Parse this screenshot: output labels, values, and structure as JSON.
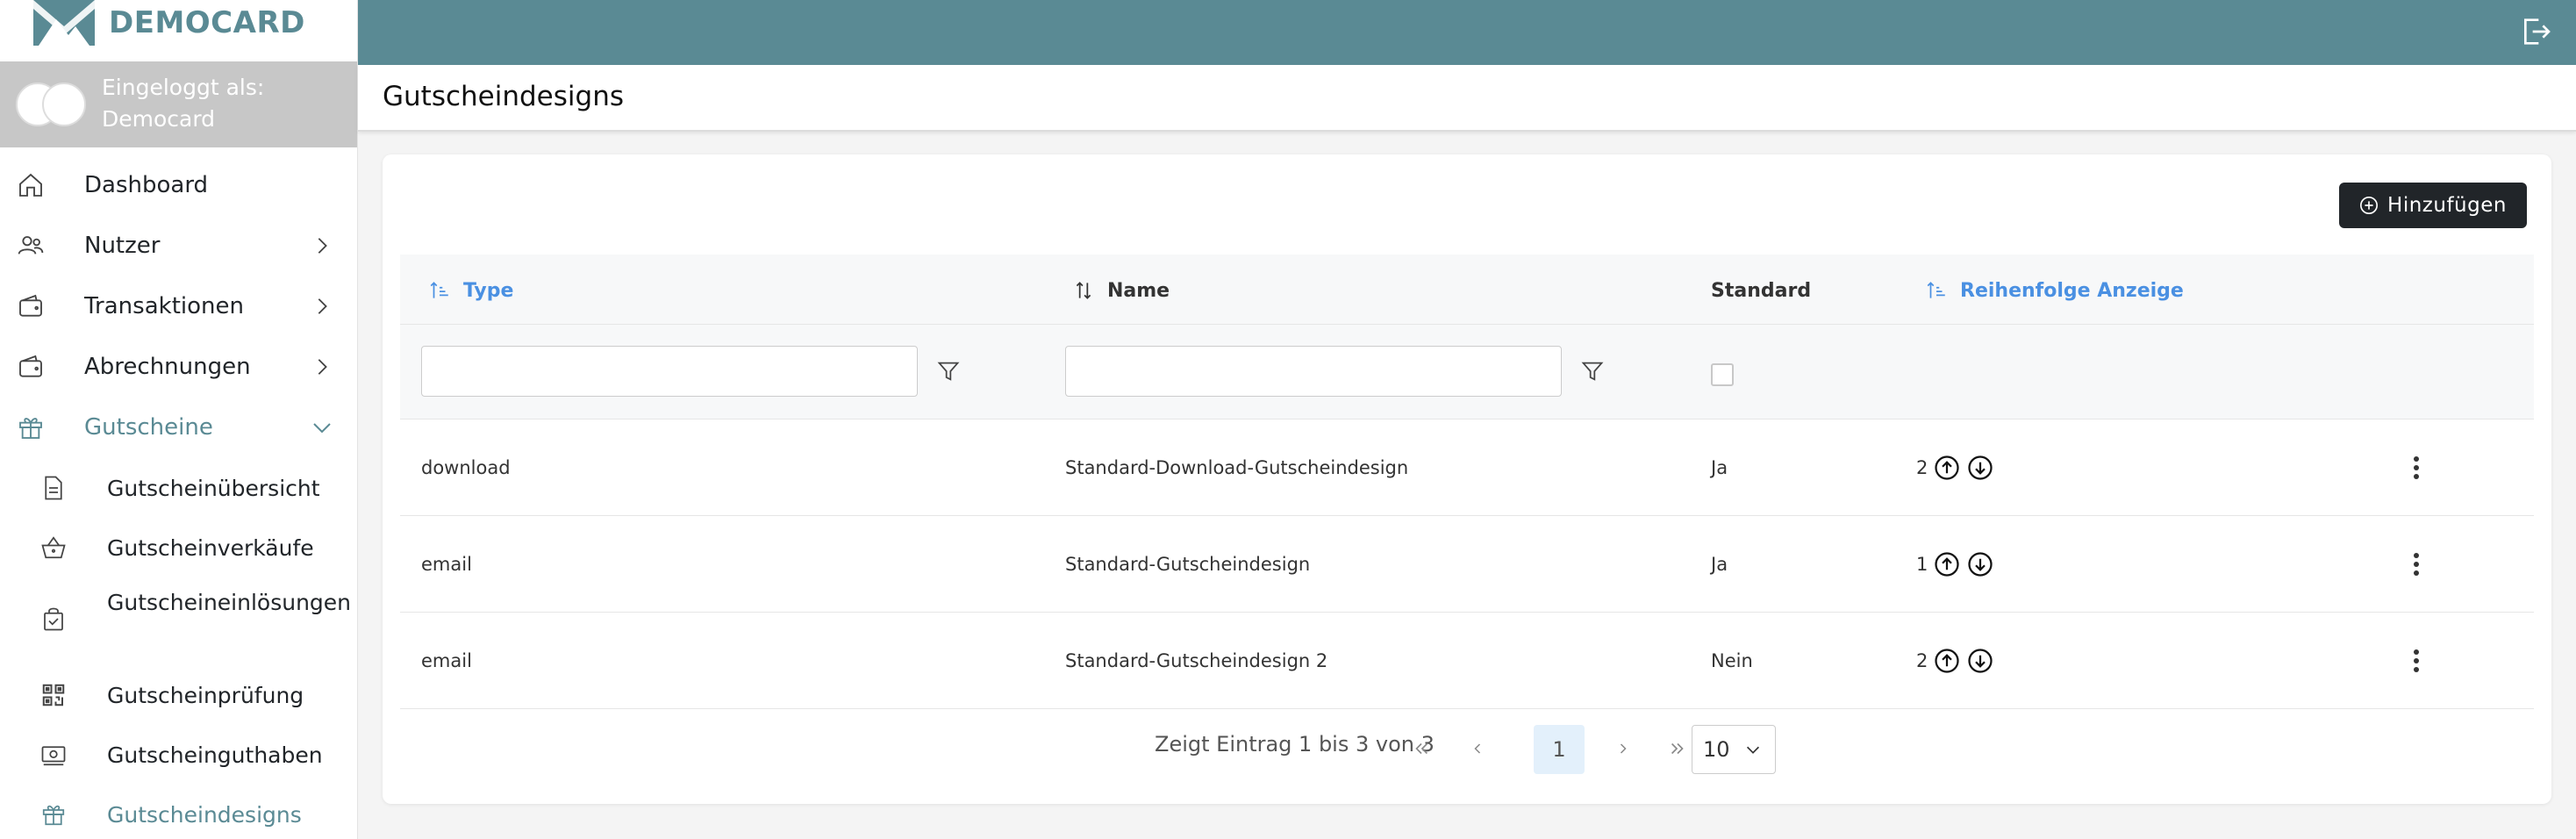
{
  "brand": {
    "name": "DEMOCARD",
    "accent": "#5a8a94"
  },
  "login": {
    "line1": "Eingeloggt als:",
    "line2": "Democard"
  },
  "sidebar": {
    "items": [
      {
        "label": "Dashboard",
        "icon": "home-icon"
      },
      {
        "label": "Nutzer",
        "icon": "users-icon",
        "chevron": "right"
      },
      {
        "label": "Transaktionen",
        "icon": "wallet-icon",
        "chevron": "right"
      },
      {
        "label": "Abrechnungen",
        "icon": "wallet-icon",
        "chevron": "right"
      },
      {
        "label": "Gutscheine",
        "icon": "gift-icon",
        "chevron": "down",
        "active": true
      }
    ],
    "subitems": [
      {
        "label": "Gutscheinübersicht",
        "icon": "document-icon"
      },
      {
        "label": "Gutscheinverkäufe",
        "icon": "basket-icon"
      },
      {
        "label": "Gutscheineinlösungen",
        "icon": "bag-check-icon"
      },
      {
        "label": "Gutscheinprüfung",
        "icon": "qr-code-icon"
      },
      {
        "label": "Gutscheinguthaben",
        "icon": "cash-icon"
      },
      {
        "label": "Gutscheindesigns",
        "icon": "gift-icon",
        "active": true
      }
    ]
  },
  "page": {
    "title": "Gutscheindesigns"
  },
  "toolbar": {
    "add_label": "Hinzufügen"
  },
  "table": {
    "columns": [
      "Type",
      "Name",
      "Standard",
      "Reihenfolge Anzeige"
    ],
    "rows": [
      {
        "type": "download",
        "name": "Standard-Download-Gutscheindesign",
        "standard": "Ja",
        "order": "2"
      },
      {
        "type": "email",
        "name": "Standard-Gutscheindesign",
        "standard": "Ja",
        "order": "1"
      },
      {
        "type": "email",
        "name": "Standard-Gutscheindesign 2",
        "standard": "Nein",
        "order": "2"
      }
    ]
  },
  "pager": {
    "info": "Zeigt Eintrag 1 bis 3 von 3",
    "current_page": "1",
    "page_size": "10"
  }
}
